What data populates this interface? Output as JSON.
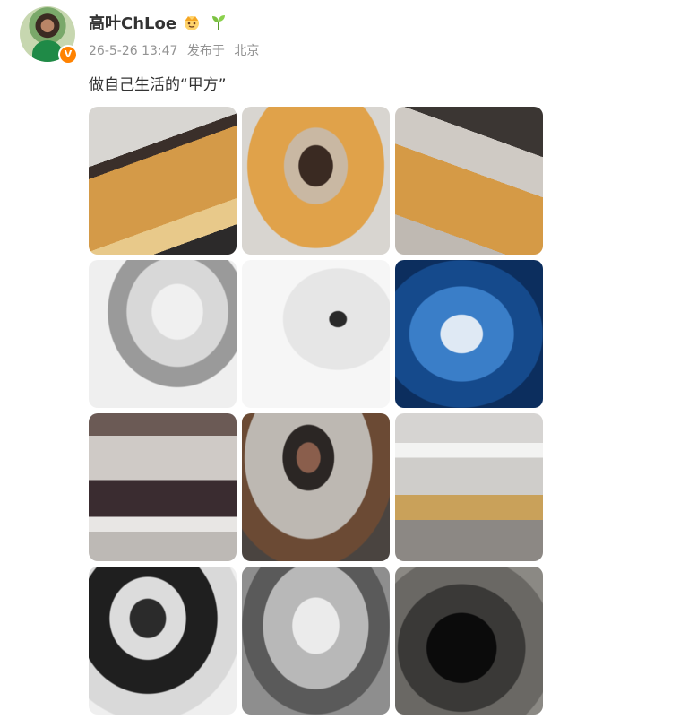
{
  "user": {
    "name": "高叶ChLoe",
    "verified_badge": "V",
    "icons": [
      "crown-icon",
      "sprout-icon"
    ]
  },
  "post": {
    "date": "26-5-26 13:47",
    "source_prefix": "发布于",
    "location": "北京",
    "text": "做自己生活的“甲方”"
  },
  "photos": [
    {
      "name": "photo-1"
    },
    {
      "name": "photo-2"
    },
    {
      "name": "photo-3"
    },
    {
      "name": "photo-4"
    },
    {
      "name": "photo-5"
    },
    {
      "name": "photo-6"
    },
    {
      "name": "photo-7"
    },
    {
      "name": "photo-8"
    },
    {
      "name": "photo-9"
    },
    {
      "name": "photo-10"
    },
    {
      "name": "photo-11"
    },
    {
      "name": "photo-12"
    }
  ],
  "colors": {
    "badge": "#ff8200",
    "meta_text": "#939393",
    "body_text": "#333333"
  }
}
